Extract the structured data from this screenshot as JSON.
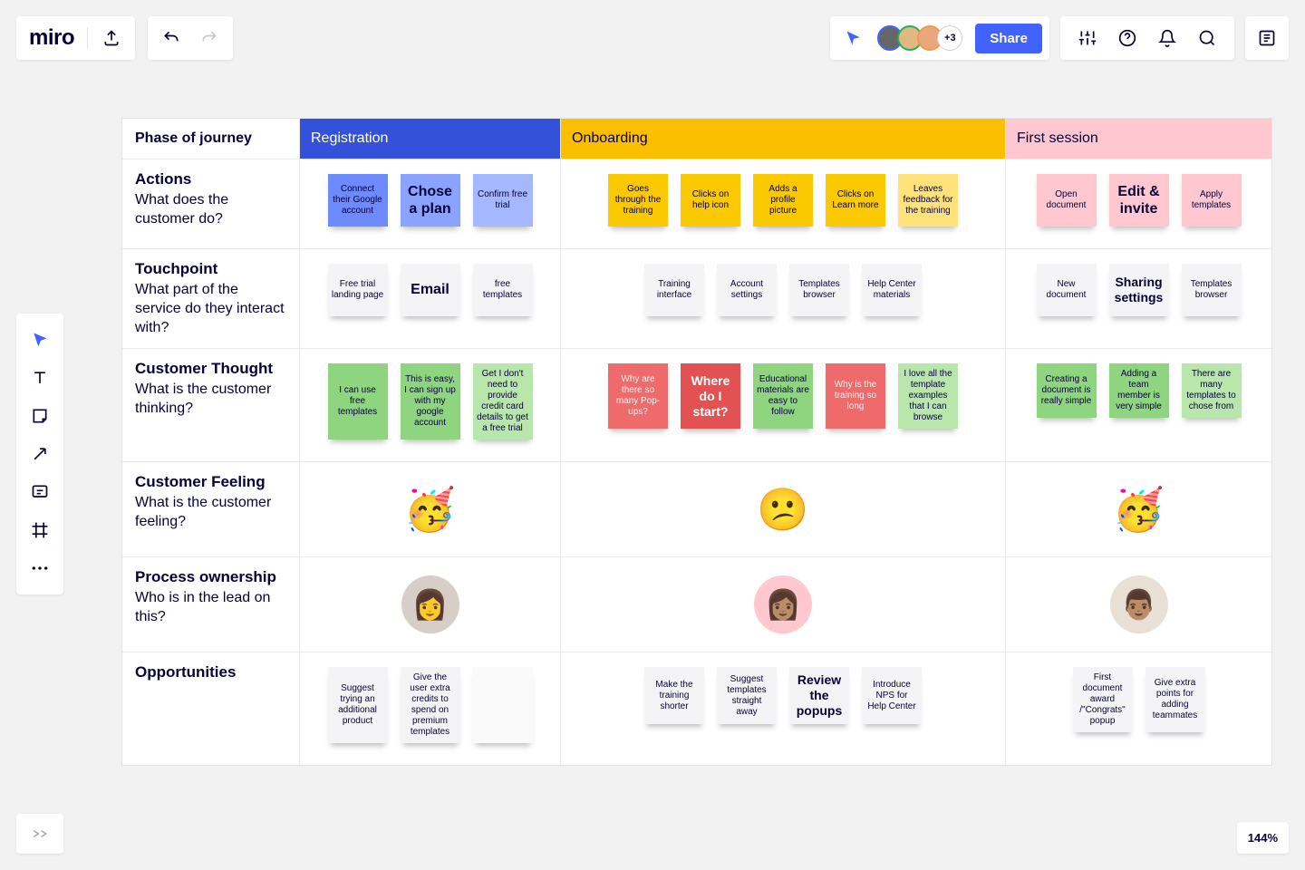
{
  "app": {
    "logo": "miro",
    "avatars_overflow": "+3",
    "share_label": "Share",
    "zoom": "144%"
  },
  "grid": {
    "top_left": "Phase of journey",
    "phases": {
      "reg": "Registration",
      "ob": "Onboarding",
      "fs": "First session"
    },
    "rows": {
      "actions": {
        "title": "Actions",
        "sub": "What does the customer do?"
      },
      "touch": {
        "title": "Touchpoint",
        "sub": "What part of the service do they interact with?"
      },
      "thought": {
        "title": "Customer Thought",
        "sub": "What is the customer thinking?"
      },
      "feeling": {
        "title": "Customer Feeling",
        "sub": "What is the customer feeling?"
      },
      "owner": {
        "title": "Process ownership",
        "sub": "Who is in the lead on this?"
      },
      "opp": {
        "title": "Opportunities",
        "sub": ""
      }
    }
  },
  "stickies": {
    "actions_reg": [
      "Connect their Google account",
      "Chose a plan",
      "Confirm free trial"
    ],
    "actions_ob": [
      "Goes through the training",
      "Clicks on help icon",
      "Adds a profile picture",
      "Clicks on Learn more",
      "Leaves feedback for the training"
    ],
    "actions_fs": [
      "Open document",
      "Edit & invite",
      "Apply templates"
    ],
    "touch_reg": [
      "Free trial landing page",
      "Email",
      "free templates"
    ],
    "touch_ob": [
      "Training interface",
      "Account settings",
      "Templates browser",
      "Help Center materials"
    ],
    "touch_fs": [
      "New document",
      "Sharing settings",
      "Templates browser"
    ],
    "thought_reg": [
      "I can use free templates",
      "This is easy, I can sign up with my google account",
      "Get I don't need to provide credit card details to get a free trial"
    ],
    "thought_ob": [
      "Why are there so many Pop-ups?",
      "Where do I start?",
      "Educational materials are easy to follow",
      "Why is the training so long",
      "I love all the template examples that I can browse"
    ],
    "thought_fs": [
      "Creating a document is really simple",
      "Adding a team member is very simple",
      "There are many templates to chose from"
    ],
    "opp_reg": [
      "Suggest trying an additional product",
      "Give the user extra credits to spend on premium templates",
      ""
    ],
    "opp_ob": [
      "Make the training shorter",
      "Suggest templates straight away",
      "Review the popups",
      "Introduce NPS for Help Center"
    ],
    "opp_fs": [
      "First document award /\"Congrats\" popup",
      "Give extra points for adding teammates"
    ]
  }
}
